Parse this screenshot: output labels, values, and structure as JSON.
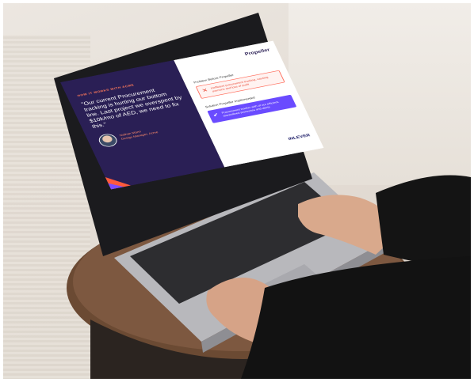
{
  "screen": {
    "kicker": "HOW IT WORKS WITH ACME",
    "quote": "\"Our current Procurement tracking is hurting our bottom line. Last project we overspent by $10k/mo of AED, we need to fix this.\"",
    "author_name": "Nathan Mann",
    "author_title": "Design Manager, Acme",
    "logo": "Propeller",
    "problem_label": "Problem Before Propeller",
    "problem_text": "Inefficient procurement tracking, causing overruns and loss of profit",
    "solution_label": "Solution Propeller Implemented",
    "solution_text": "Procurement tracker with of our efficient, streamlined processes and alerts",
    "brand": "INLEVER"
  },
  "colors": {
    "left_panel": "#2a1f55",
    "accent_orange": "#ff5a3c",
    "accent_purple": "#6a4bff",
    "problem_red": "#e8402c"
  }
}
